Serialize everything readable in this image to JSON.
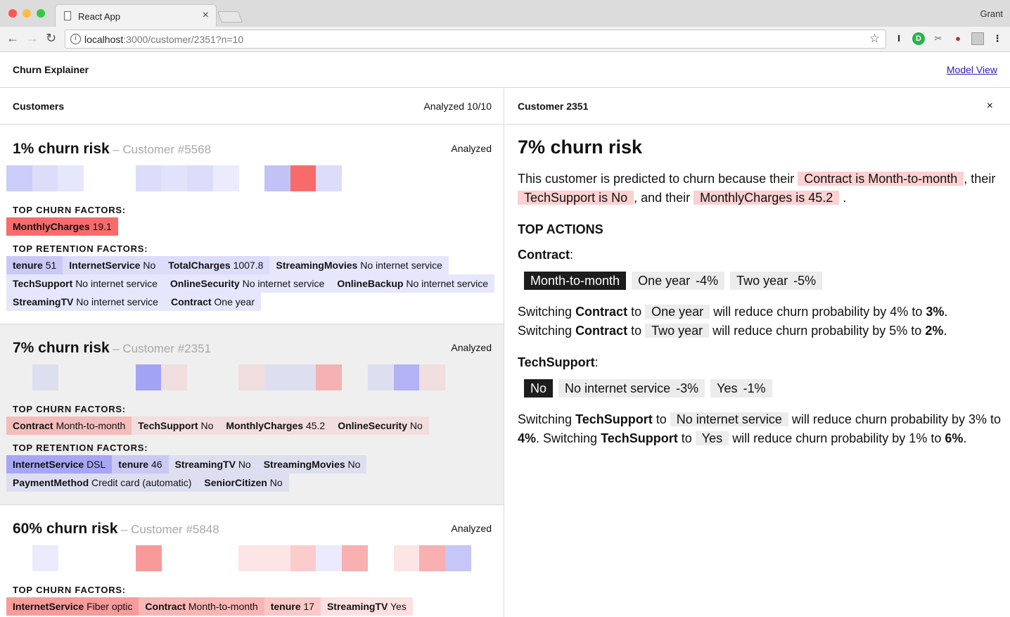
{
  "browser": {
    "tab_title": "React App",
    "tab_close": "×",
    "profile": "Grant",
    "url_host": "localhost",
    "url_rest": ":3000/customer/2351?n=10"
  },
  "app": {
    "title": "Churn Explainer",
    "model_link": "Model View"
  },
  "left": {
    "title": "Customers",
    "count": "Analyzed 10/10",
    "churn_label": "TOP CHURN FACTORS:",
    "retention_label": "TOP RETENTION FACTORS:",
    "cards": [
      {
        "risk": "1% churn risk",
        "customer": "– Customer #5568",
        "status": "Analyzed",
        "cells": [
          "#cdcdfb",
          "#dcdcfb",
          "#e6e6fd",
          "",
          "",
          "#dcdcfb",
          "#e2e2fd",
          "#dcdcfb",
          "#ebebfd",
          "",
          "#c2c2f7",
          "#f86b6b",
          "#dcdcfb"
        ],
        "churn": [
          {
            "name": "MonthlyCharges",
            "value": "19.1",
            "color": "#f76b6b"
          }
        ],
        "retention": [
          {
            "name": "tenure",
            "value": "51",
            "color": "#c9c9f7"
          },
          {
            "name": "InternetService",
            "value": "No",
            "color": "#dcdcfb"
          },
          {
            "name": "TotalCharges",
            "value": "1007.8",
            "color": "#dcdcfb"
          },
          {
            "name": "StreamingMovies",
            "value": "No internet service",
            "color": "#e6e6fd"
          },
          {
            "name": "TechSupport",
            "value": "No internet service",
            "color": "#e6e6fd"
          },
          {
            "name": "OnlineSecurity",
            "value": "No internet service",
            "color": "#e6e6fd"
          },
          {
            "name": "OnlineBackup",
            "value": "No internet service",
            "color": "#e6e6fd"
          },
          {
            "name": "StreamingTV",
            "value": "No internet service",
            "color": "#e6e6fd"
          },
          {
            "name": "Contract",
            "value": "One year",
            "color": "#e6e6fd"
          }
        ]
      },
      {
        "risk": "7% churn risk",
        "customer": "– Customer #2351",
        "status": "Analyzed",
        "cells": [
          "",
          "#dedef1",
          "",
          "",
          "",
          "#a3a3f5",
          "#f1dede",
          "",
          "",
          "#f1dede",
          "#dedef1",
          "#dedef1",
          "#f4b2b2",
          "",
          "#dedef1",
          "#b2b2f5",
          "#f1dede"
        ],
        "churn": [
          {
            "name": "Contract",
            "value": "Month-to-month",
            "color": "#f5bcbc"
          },
          {
            "name": "TechSupport",
            "value": "No",
            "color": "#f2dede"
          },
          {
            "name": "MonthlyCharges",
            "value": "45.2",
            "color": "#f2dede"
          },
          {
            "name": "OnlineSecurity",
            "value": "No",
            "color": "#f2dede"
          }
        ],
        "retention": [
          {
            "name": "InternetService",
            "value": "DSL",
            "color": "#a6a6f5"
          },
          {
            "name": "tenure",
            "value": "46",
            "color": "#c9c9f3"
          },
          {
            "name": "StreamingTV",
            "value": "No",
            "color": "#dedef1"
          },
          {
            "name": "StreamingMovies",
            "value": "No",
            "color": "#dedef1"
          },
          {
            "name": "PaymentMethod",
            "value": "Credit card (automatic)",
            "color": "#dedef1"
          },
          {
            "name": "SeniorCitizen",
            "value": "No",
            "color": "#dedef1"
          }
        ]
      },
      {
        "risk": "60% churn risk",
        "customer": "– Customer #5848",
        "status": "Analyzed",
        "cells": [
          "",
          "#ebebfd",
          "",
          "",
          "",
          "#f99a9a",
          "",
          "",
          "",
          "#fde5e5",
          "#fde5e5",
          "#fbcccc",
          "#ebebfd",
          "#f8b0b0",
          "",
          "#fde5e5",
          "#f8b0b0",
          "#c6c6f8"
        ],
        "churn": [
          {
            "name": "InternetService",
            "value": "Fiber optic",
            "color": "#f79b9b"
          },
          {
            "name": "Contract",
            "value": "Month-to-month",
            "color": "#f8b6b6"
          },
          {
            "name": "tenure",
            "value": "17",
            "color": "#fbc8c8"
          },
          {
            "name": "StreamingTV",
            "value": "Yes",
            "color": "#fde0e0"
          }
        ],
        "retention": []
      }
    ]
  },
  "right": {
    "title": "Customer 2351",
    "close": "×",
    "risk": "7% churn risk",
    "reason": {
      "pre": "This customer is predicted to churn because their",
      "f1": "Contract is Month-to-month",
      "mid1": ", their",
      "f2": "TechSupport is No",
      "mid2": ", and their",
      "f3": "MonthlyCharges is 45.2",
      "end": "."
    },
    "actions_title": "TOP ACTIONS",
    "contract": {
      "label": "Contract",
      "colon": ":",
      "options": [
        {
          "label": "Month-to-month",
          "delta": "",
          "current": true
        },
        {
          "label": "One year",
          "delta": "-4%",
          "current": false
        },
        {
          "label": "Two year",
          "delta": "-5%",
          "current": false
        }
      ],
      "lines": [
        {
          "pre": "Switching",
          "feat": "Contract",
          "to": "to",
          "opt": "One year",
          "post": "will reduce churn probability by 4% to",
          "result": "3%",
          "end": "."
        },
        {
          "pre": "Switching",
          "feat": "Contract",
          "to": "to",
          "opt": "Two year",
          "post": "will reduce churn probability by 5% to",
          "result": "2%",
          "end": "."
        }
      ]
    },
    "techsupport": {
      "label": "TechSupport",
      "colon": ":",
      "options": [
        {
          "label": "No",
          "delta": "",
          "current": true
        },
        {
          "label": "No internet service",
          "delta": "-3%",
          "current": false
        },
        {
          "label": "Yes",
          "delta": "-1%",
          "current": false
        }
      ],
      "text": {
        "pre1": "Switching",
        "feat1": "TechSupport",
        "to1": "to",
        "opt1": "No internet service",
        "post1": "will reduce churn probability by 3% to",
        "res1": "4%",
        "dot1": ". Switching",
        "feat2": "TechSupport",
        "to2": "to",
        "opt2": "Yes",
        "post2": "will reduce churn probability by 1% to",
        "res2": "6%",
        "dot2": "."
      }
    }
  }
}
